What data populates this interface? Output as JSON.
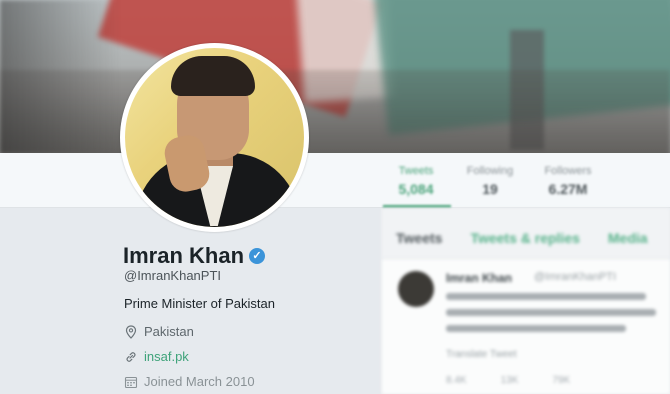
{
  "profile": {
    "name": "Imran Khan",
    "handle": "@ImranKhanPTI",
    "bio": "Prime Minister of Pakistan",
    "location": "Pakistan",
    "website": "insaf.pk",
    "joined": "Joined March 2010"
  },
  "stats": [
    {
      "label": "Tweets",
      "value": "5,084",
      "active": true
    },
    {
      "label": "Following",
      "value": "19",
      "active": false
    },
    {
      "label": "Followers",
      "value": "6.27M",
      "active": false
    }
  ],
  "tweets_panel": {
    "tabs": [
      "Tweets",
      "Tweets & replies",
      "Media"
    ],
    "tweet": {
      "author": "Imran Khan",
      "handle": "@ImranKhanPTI",
      "translate": "Translate Tweet",
      "actions": [
        "8.4K",
        "13K",
        "79K"
      ]
    }
  },
  "colors": {
    "accent": "#4aa37a",
    "verified": "#3b94d9",
    "link": "#3fa37a"
  },
  "icons": [
    "verified-badge-icon",
    "location-pin-icon",
    "link-icon",
    "calendar-icon"
  ]
}
